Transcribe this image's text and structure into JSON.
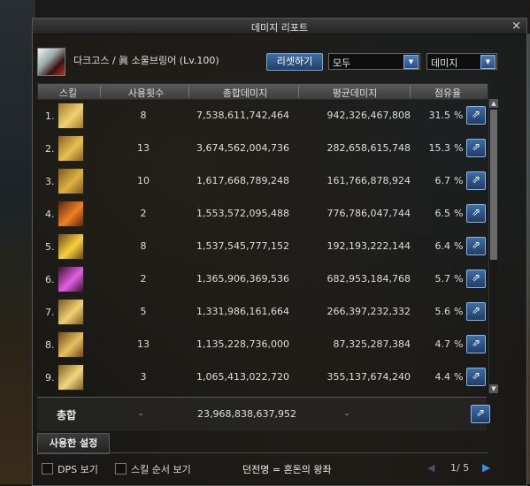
{
  "window": {
    "title": "데미지 리포트",
    "close_label": "×"
  },
  "character": {
    "name": "다크고스 / 眞 소울브링어 (Lv.100)"
  },
  "controls": {
    "reset_label": "리셋하기",
    "filter_value": "모두",
    "metric_value": "데미지"
  },
  "table": {
    "headers": [
      "스킬",
      "사용횟수",
      "총합데미지",
      "평균데미지",
      "점유율"
    ],
    "percent_unit": "%",
    "rows": [
      {
        "rank": "1.",
        "uses": "8",
        "total": "7,538,611,742,464",
        "avg": "942,326,467,808",
        "pct": "31.5",
        "color_a": "#a07a2a",
        "color_b": "#f0d070"
      },
      {
        "rank": "2.",
        "uses": "13",
        "total": "3,674,562,004,736",
        "avg": "282,658,615,748",
        "pct": "15.3",
        "color_a": "#8a6020",
        "color_b": "#e8c050"
      },
      {
        "rank": "3.",
        "uses": "10",
        "total": "1,617,668,789,248",
        "avg": "161,766,878,924",
        "pct": "6.7",
        "color_a": "#7a5a1f",
        "color_b": "#e0b040"
      },
      {
        "rank": "4.",
        "uses": "2",
        "total": "1,553,572,095,488",
        "avg": "776,786,047,744",
        "pct": "6.5",
        "color_a": "#5a2410",
        "color_b": "#f08020"
      },
      {
        "rank": "5.",
        "uses": "8",
        "total": "1,537,545,777,152",
        "avg": "192,193,222,144",
        "pct": "6.4",
        "color_a": "#6a4a10",
        "color_b": "#f8d040"
      },
      {
        "rank": "6.",
        "uses": "2",
        "total": "1,365,906,369,536",
        "avg": "682,953,184,768",
        "pct": "5.7",
        "color_a": "#3a1030",
        "color_b": "#e060e0"
      },
      {
        "rank": "7.",
        "uses": "5",
        "total": "1,331,986,161,664",
        "avg": "266,397,232,332",
        "pct": "5.6",
        "color_a": "#7a5a20",
        "color_b": "#f0d070"
      },
      {
        "rank": "8.",
        "uses": "13",
        "total": "1,135,228,736,000",
        "avg": "87,325,287,384",
        "pct": "4.7",
        "color_a": "#6a4a18",
        "color_b": "#e8c060"
      },
      {
        "rank": "9.",
        "uses": "3",
        "total": "1,065,413,022,720",
        "avg": "355,137,674,240",
        "pct": "4.4",
        "color_a": "#7a6020",
        "color_b": "#f0d880"
      }
    ]
  },
  "summary": {
    "label": "총합",
    "uses": "-",
    "total": "23,968,838,637,952",
    "avg": "-"
  },
  "settings": {
    "tab_label": "사용한 설정"
  },
  "footer": {
    "dps_label": "DPS 보기",
    "order_label": "스킬 순서 보기",
    "dungeon": "던전명 = 혼돈의 왕좌",
    "page": "1/ 5"
  }
}
